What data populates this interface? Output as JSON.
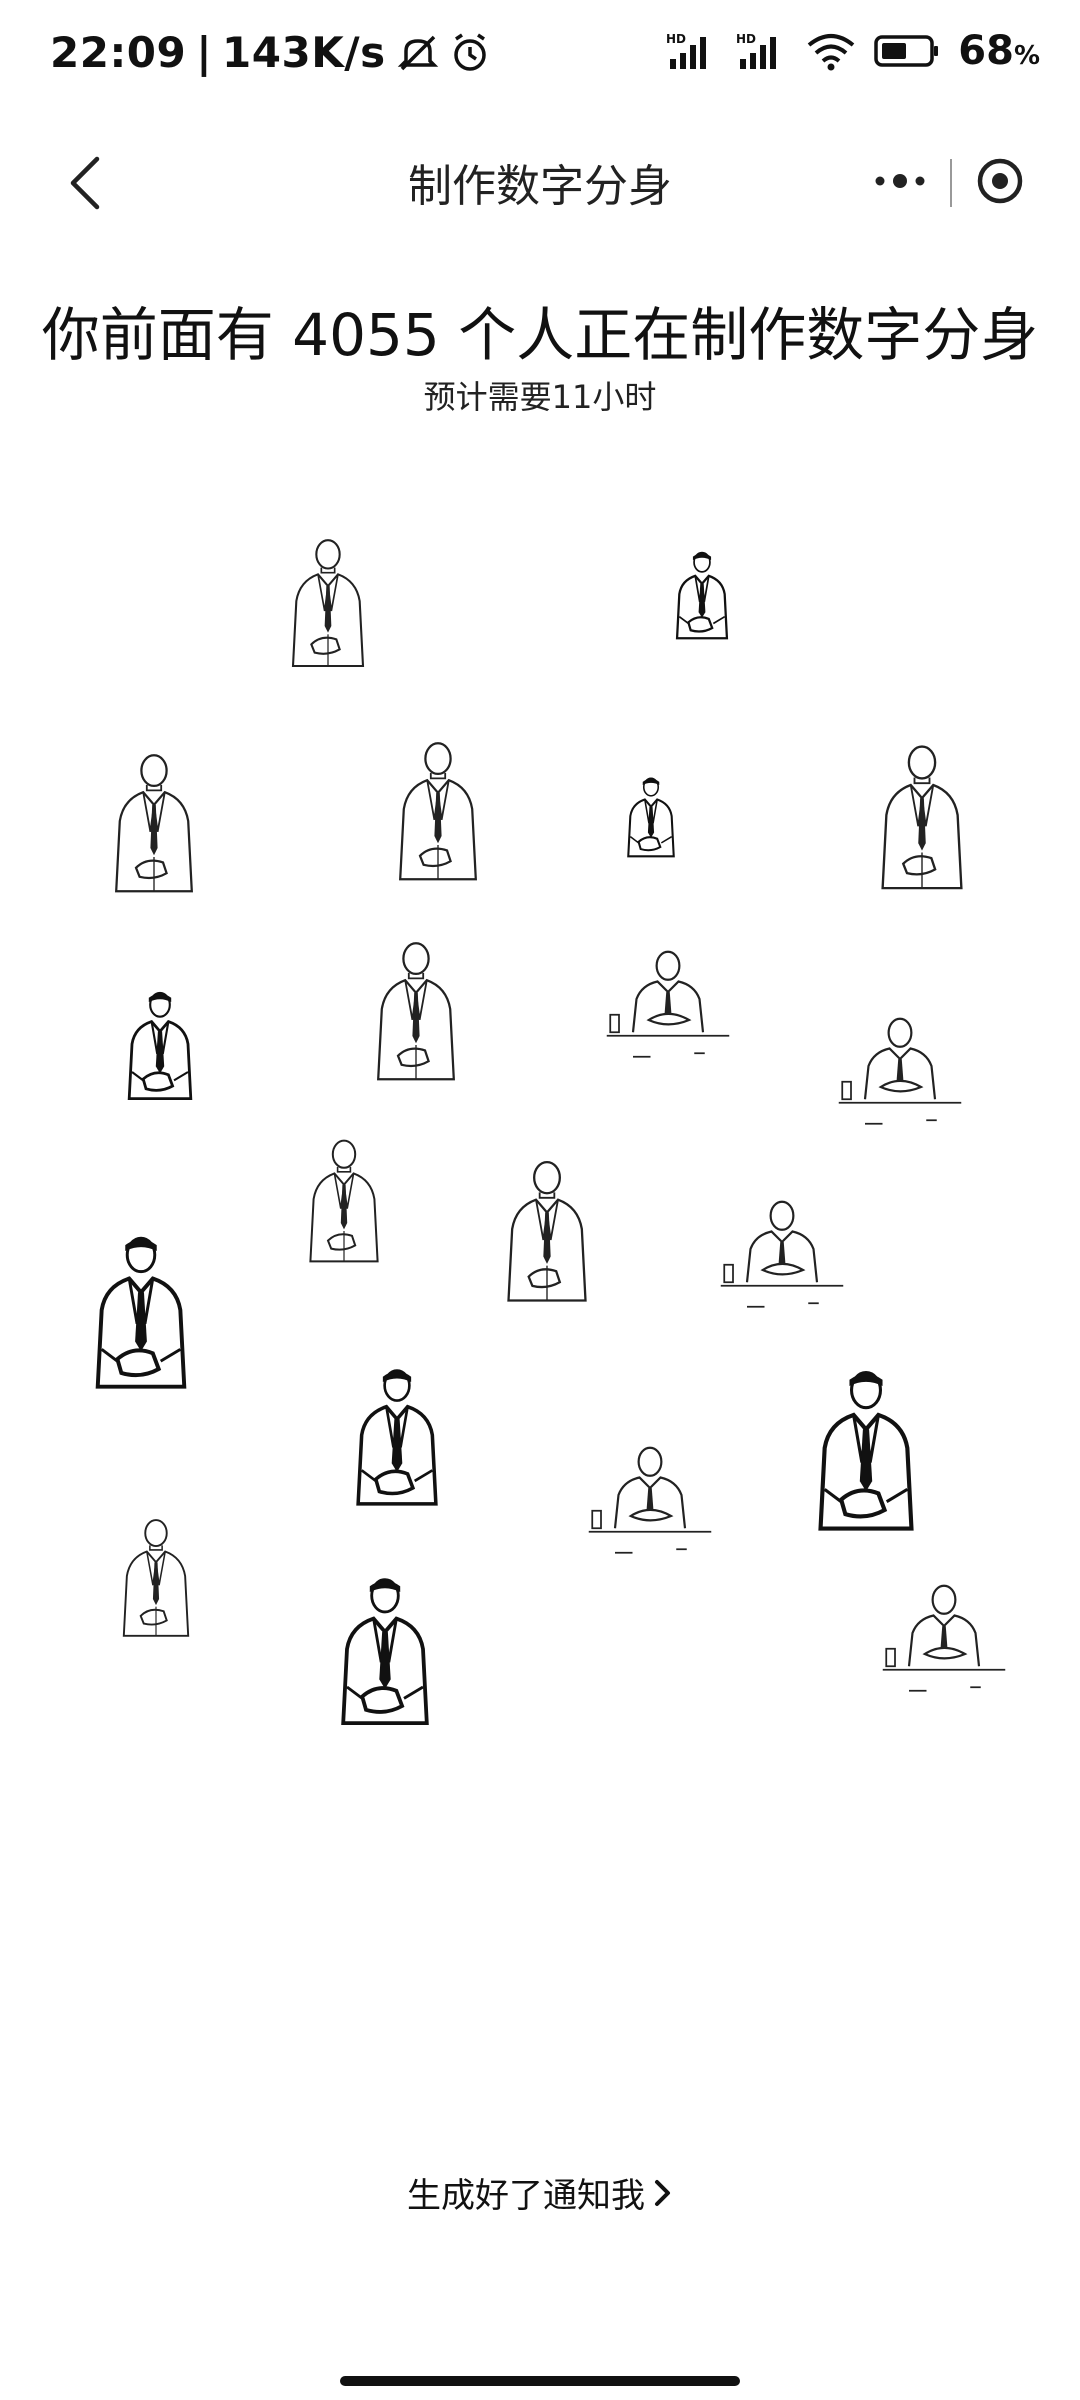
{
  "status_bar": {
    "time": "22:09",
    "net_speed": "143K/s",
    "battery": "68",
    "battery_unit": "%",
    "icons": [
      "mute-icon",
      "alarm-icon",
      "signal-hd-icon",
      "signal-hd-icon",
      "wifi-icon",
      "battery-icon"
    ]
  },
  "title_bar": {
    "title": "制作数字分身",
    "back_icon": "chevron-left-icon",
    "more_icon": "more-dots-icon",
    "close_icon": "target-circle-icon"
  },
  "queue": {
    "headline": "你前面有 4055 个人正在制作数字分身",
    "estimate": "预计需要11小时"
  },
  "notify": {
    "label": "生成好了通知我",
    "icon": "chevron-right-icon"
  },
  "colors": {
    "background": "#ffffff",
    "text": "#111111",
    "divider": "#999999"
  }
}
